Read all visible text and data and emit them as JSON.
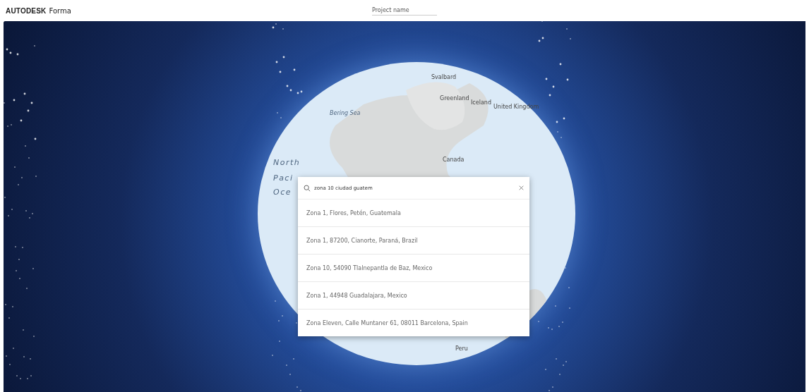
{
  "header": {
    "logo_brand": "AUTODESK",
    "logo_product": "Forma",
    "project_name": {
      "placeholder": "Project name"
    }
  },
  "map_labels": [
    {
      "text": "Svalbard",
      "kind": "country"
    },
    {
      "text": "Greenland",
      "kind": "country"
    },
    {
      "text": "Iceland",
      "kind": "country"
    },
    {
      "text": "United Kingdom",
      "kind": "country"
    },
    {
      "text": "Bering Sea",
      "kind": "sea"
    },
    {
      "text": "Canada",
      "kind": "country"
    },
    {
      "text": "North",
      "kind": "ocean"
    },
    {
      "text": "Paci",
      "kind": "ocean"
    },
    {
      "text": "Oce",
      "kind": "ocean"
    },
    {
      "text": "Peru",
      "kind": "country"
    }
  ],
  "search": {
    "value": "zona 10 ciudad guatem",
    "results": [
      "Zona 1, Flores, Petén, Guatemala",
      "Zona 1, 87200, Cianorte, Paraná, Brazil",
      "Zona 10, 54090 Tlalnepantla de Baz, Mexico",
      "Zona 1, 44948 Guadalajara, Mexico",
      "Zona Eleven, Calle Muntaner 61, 08011 Barcelona, Spain"
    ]
  }
}
